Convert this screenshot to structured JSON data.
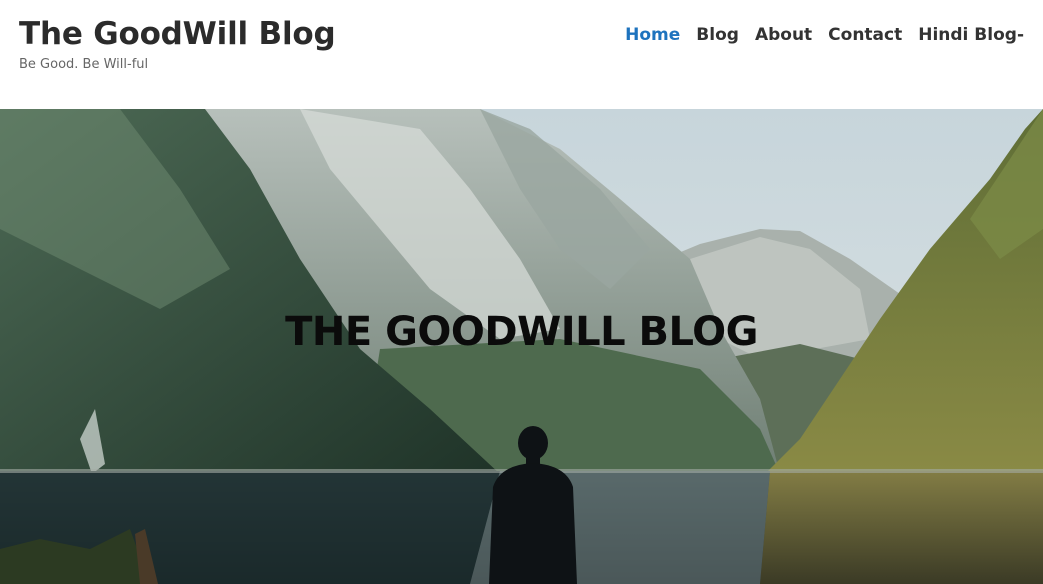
{
  "site": {
    "title": "The GoodWill Blog",
    "tagline": "Be Good. Be Will-ful"
  },
  "nav": {
    "items": [
      {
        "label": "Home",
        "active": true
      },
      {
        "label": "Blog",
        "active": false
      },
      {
        "label": "About",
        "active": false
      },
      {
        "label": "Contact",
        "active": false
      },
      {
        "label": "Hindi Blog-",
        "active": false
      }
    ]
  },
  "hero": {
    "title": "THE GOODWILL BLOG",
    "image": "mountain-lake-person-photo"
  },
  "colors": {
    "accent": "#1e73be",
    "text": "#333333",
    "sky": "#c9d6da",
    "water": "#1e3036"
  }
}
